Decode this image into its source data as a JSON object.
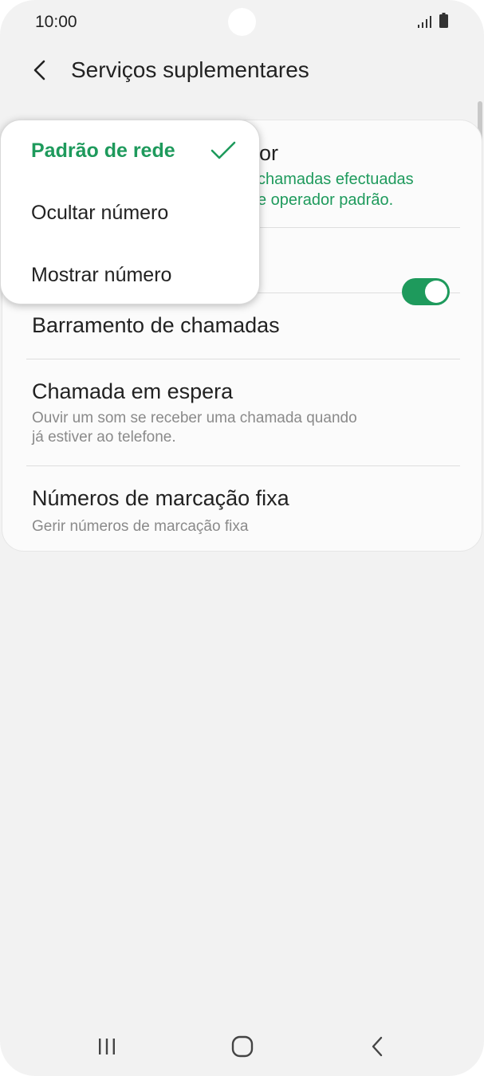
{
  "status": {
    "time": "10:00"
  },
  "header": {
    "title": "Serviços suplementares"
  },
  "settings": {
    "caller_id": {
      "title_partial": "or",
      "subtitle_line1": "chamadas efectuadas",
      "subtitle_line2": "e operador padrão."
    },
    "call_barring": {
      "title": "Barramento de chamadas"
    },
    "call_waiting": {
      "title": "Chamada em espera",
      "subtitle_line1": "Ouvir um som se receber uma chamada quando",
      "subtitle_line2": "já estiver ao telefone.",
      "enabled": true
    },
    "fixed_dialing": {
      "title": "Números de marcação fixa",
      "subtitle": "Gerir números de marcação fixa"
    }
  },
  "popup": {
    "options": [
      {
        "label": "Padrão de rede",
        "selected": true
      },
      {
        "label": "Ocultar número",
        "selected": false
      },
      {
        "label": "Mostrar número",
        "selected": false
      }
    ]
  },
  "colors": {
    "accent": "#1e9a5c",
    "background": "#f2f2f2"
  },
  "icons": {
    "back": "back-arrow-icon",
    "check": "check-icon",
    "signal": "signal-icon",
    "battery": "battery-icon",
    "recents": "recents-icon",
    "home": "home-icon",
    "nav_back": "nav-back-icon"
  }
}
